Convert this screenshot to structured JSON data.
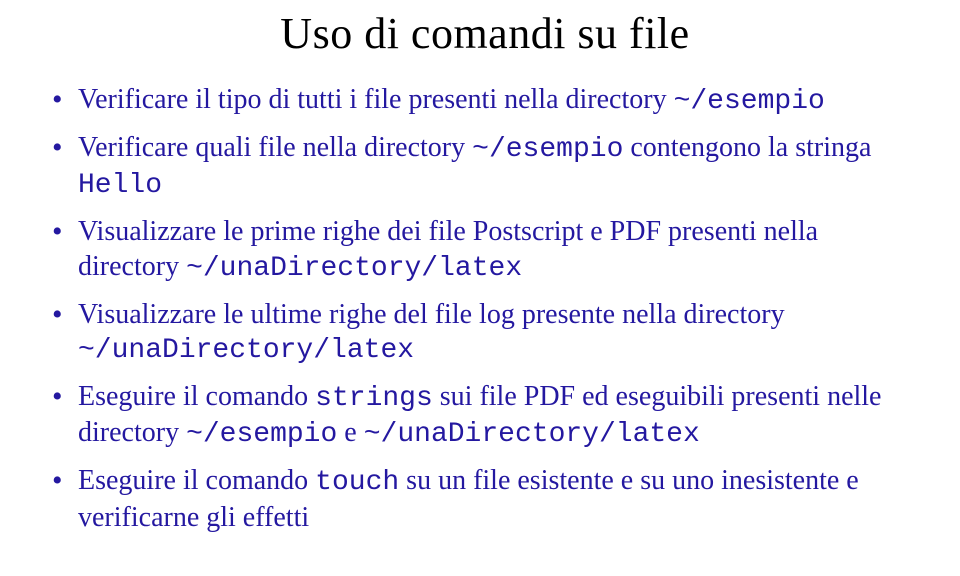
{
  "title": "Uso di comandi su file",
  "bullets": [
    {
      "parts": [
        {
          "text": "Verificare il tipo di tutti i file presenti nella directory ",
          "code": false
        },
        {
          "text": "~/esempio",
          "code": true
        }
      ]
    },
    {
      "parts": [
        {
          "text": "Verificare quali file nella directory ",
          "code": false
        },
        {
          "text": "~/esempio",
          "code": true
        },
        {
          "text": " contengono la stringa ",
          "code": false
        },
        {
          "text": "Hello",
          "code": true
        }
      ]
    },
    {
      "parts": [
        {
          "text": "Visualizzare le prime righe dei file Postscript e PDF presenti nella directory ",
          "code": false
        },
        {
          "text": "~/unaDirectory/latex",
          "code": true
        }
      ]
    },
    {
      "parts": [
        {
          "text": "Visualizzare le ultime righe del file log presente nella directory ",
          "code": false
        },
        {
          "text": "~/unaDirectory/latex",
          "code": true
        }
      ]
    },
    {
      "parts": [
        {
          "text": "Eseguire il comando ",
          "code": false
        },
        {
          "text": "strings",
          "code": true
        },
        {
          "text": " sui file PDF ed eseguibili presenti nelle directory ",
          "code": false
        },
        {
          "text": "~/esempio",
          "code": true
        },
        {
          "text": " e ",
          "code": false
        },
        {
          "text": "~/unaDirectory/latex",
          "code": true
        }
      ]
    },
    {
      "parts": [
        {
          "text": "Eseguire il comando ",
          "code": false
        },
        {
          "text": "touch",
          "code": true
        },
        {
          "text": " su un file esistente e su uno inesistente e verificarne gli effetti",
          "code": false
        }
      ]
    }
  ]
}
